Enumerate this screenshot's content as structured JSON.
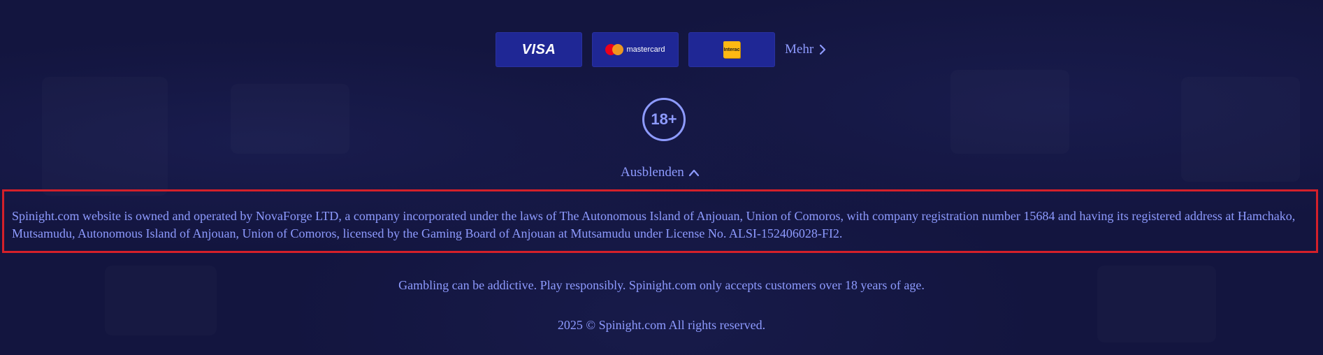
{
  "payments": {
    "methods": [
      {
        "name": "VISA",
        "icon": "visa-logo"
      },
      {
        "name": "mastercard",
        "icon": "mastercard-logo"
      },
      {
        "name": "Interac",
        "icon": "interac-logo"
      }
    ],
    "more_label": "Mehr"
  },
  "age_badge": {
    "text": "18+"
  },
  "toggle": {
    "label": "Ausblenden"
  },
  "license": {
    "text": "Spinight.com website is owned and operated by NovaForge LTD, a company incorporated under the laws of The Autonomous Island of Anjouan, Union of Comoros, with company registration number 15684 and having its registered address at Hamchako, Mutsamudu, Autonomous Island of Anjouan, Union of Comoros, licensed by the Gaming Board of Anjouan at Mutsamudu under License No. ALSI-152406028-FI2."
  },
  "footer": {
    "responsible_gambling": "Gambling can be addictive. Play responsibly. Spinight.com only accepts customers over 18 years of age.",
    "copyright": "2025 © Spinight.com All rights reserved."
  },
  "colors": {
    "background": "#13153f",
    "text": "#8e9bff",
    "card": "#1f2795",
    "highlight_border": "#d4202a"
  }
}
